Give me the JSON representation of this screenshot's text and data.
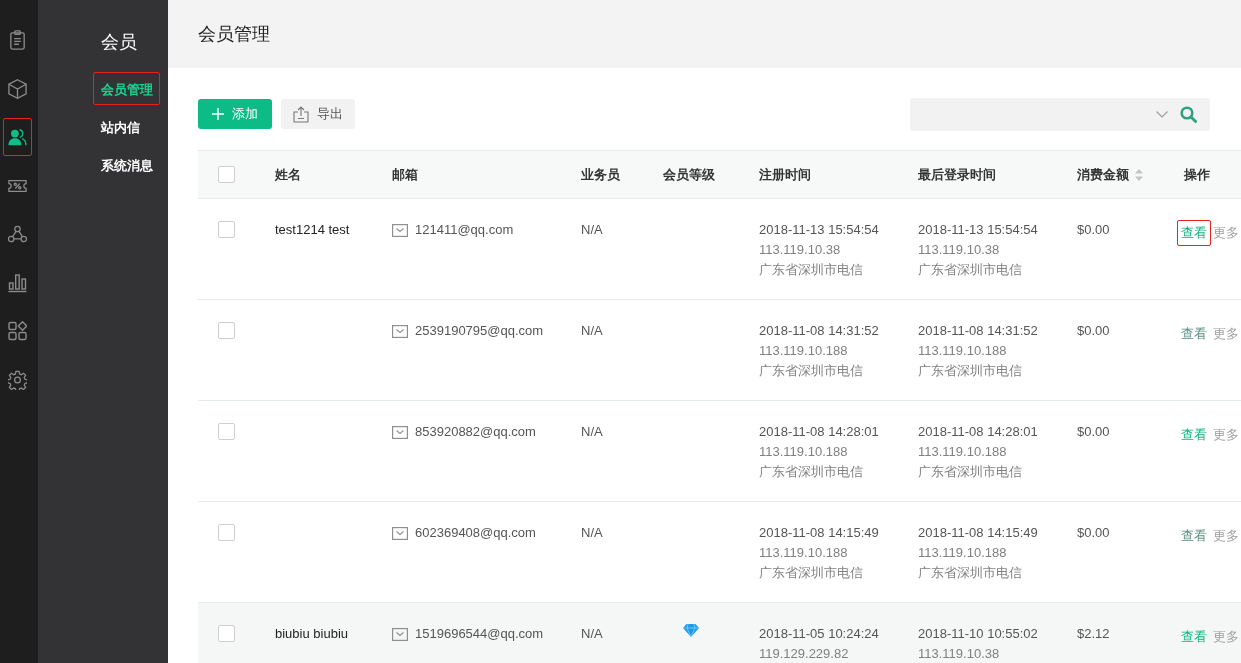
{
  "rail": {
    "items": [
      {
        "kind": "clipboard",
        "selected": false,
        "marked": false
      },
      {
        "kind": "cube",
        "selected": false,
        "marked": false
      },
      {
        "kind": "people",
        "selected": true,
        "marked": true
      },
      {
        "kind": "coupon",
        "selected": false,
        "marked": false
      },
      {
        "kind": "nodes",
        "selected": false,
        "marked": false
      },
      {
        "kind": "chart",
        "selected": false,
        "marked": false
      },
      {
        "kind": "apps",
        "selected": false,
        "marked": false
      },
      {
        "kind": "settings",
        "selected": false,
        "marked": false
      }
    ]
  },
  "sidebar": {
    "title": "会员",
    "items": [
      {
        "label": "会员管理",
        "selected": true,
        "marked": true
      },
      {
        "label": "站内信",
        "selected": false,
        "marked": false
      },
      {
        "label": "系统消息",
        "selected": false,
        "marked": false
      }
    ]
  },
  "header": {
    "title": "会员管理"
  },
  "toolbar": {
    "buttons": [
      {
        "kind": "add",
        "label": "添加"
      },
      {
        "kind": "export",
        "label": "导出"
      }
    ]
  },
  "table": {
    "header_checked": false,
    "columns": [
      {
        "label": "姓名",
        "sortable": false
      },
      {
        "label": "邮箱",
        "sortable": false
      },
      {
        "label": "业务员",
        "sortable": false
      },
      {
        "label": "会员等级",
        "sortable": false
      },
      {
        "label": "注册时间",
        "sortable": false
      },
      {
        "label": "最后登录时间",
        "sortable": false
      },
      {
        "label": "消费金额",
        "sortable": true
      },
      {
        "label": "操作",
        "sortable": false
      }
    ],
    "rows": [
      {
        "checked": false,
        "hovered": false,
        "name": "test1214 test",
        "email": "121411@qq.com",
        "salesperson": "N/A",
        "level_badge": false,
        "registered": {
          "time": "2018-11-13 15:54:54",
          "ip": "113.119.10.38",
          "location": "广东省深圳市电信"
        },
        "last_login": {
          "time": "2018-11-13 15:54:54",
          "ip": "113.119.10.38",
          "location": "广东省深圳市电信"
        },
        "amount": "$0.00",
        "actions": [
          {
            "kind": "view",
            "label": "查看",
            "muted": false,
            "marked": true
          },
          {
            "kind": "more",
            "label": "更多",
            "muted": false,
            "marked": false
          }
        ]
      },
      {
        "checked": false,
        "hovered": false,
        "email": "2539190795@qq.com",
        "salesperson": "N/A",
        "level_badge": false,
        "registered": {
          "time": "2018-11-08 14:31:52",
          "ip": "113.119.10.188",
          "location": "广东省深圳市电信"
        },
        "last_login": {
          "time": "2018-11-08 14:31:52",
          "ip": "113.119.10.188",
          "location": "广东省深圳市电信"
        },
        "amount": "$0.00",
        "actions": [
          {
            "kind": "view",
            "label": "查看",
            "muted": true,
            "marked": false
          },
          {
            "kind": "more",
            "label": "更多",
            "muted": false,
            "marked": false
          }
        ]
      },
      {
        "checked": false,
        "hovered": false,
        "email": "853920882@qq.com",
        "salesperson": "N/A",
        "level_badge": false,
        "registered": {
          "time": "2018-11-08 14:28:01",
          "ip": "113.119.10.188",
          "location": "广东省深圳市电信"
        },
        "last_login": {
          "time": "2018-11-08 14:28:01",
          "ip": "113.119.10.188",
          "location": "广东省深圳市电信"
        },
        "amount": "$0.00",
        "actions": [
          {
            "kind": "view",
            "label": "查看",
            "muted": false,
            "marked": false
          },
          {
            "kind": "more",
            "label": "更多",
            "muted": false,
            "marked": false
          }
        ]
      },
      {
        "checked": false,
        "hovered": false,
        "email": "602369408@qq.com",
        "salesperson": "N/A",
        "level_badge": false,
        "registered": {
          "time": "2018-11-08 14:15:49",
          "ip": "113.119.10.188",
          "location": "广东省深圳市电信"
        },
        "last_login": {
          "time": "2018-11-08 14:15:49",
          "ip": "113.119.10.188",
          "location": "广东省深圳市电信"
        },
        "amount": "$0.00",
        "actions": [
          {
            "kind": "view",
            "label": "查看",
            "muted": true,
            "marked": false
          },
          {
            "kind": "more",
            "label": "更多",
            "muted": false,
            "marked": false
          }
        ]
      },
      {
        "checked": false,
        "hovered": true,
        "name": "biubiu biubiu",
        "email": "1519696544@qq.com",
        "salesperson": "N/A",
        "level_badge": true,
        "registered": {
          "time": "2018-11-05 10:24:24",
          "ip": "119.129.229.82"
        },
        "last_login": {
          "time": "2018-11-10 10:55:02",
          "ip": "113.119.10.38"
        },
        "amount": "$2.12",
        "actions": [
          {
            "kind": "view",
            "label": "查看",
            "muted": false,
            "marked": false
          },
          {
            "kind": "more",
            "label": "更多",
            "muted": false,
            "marked": false
          }
        ]
      }
    ]
  }
}
